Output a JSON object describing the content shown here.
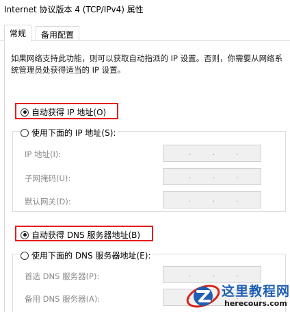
{
  "window": {
    "title": "Internet 协议版本 4 (TCP/IPv4) 属性"
  },
  "tabs": [
    {
      "label": "常规",
      "active": true
    },
    {
      "label": "备用配置",
      "active": false
    }
  ],
  "description": "如果网络支持此功能，则可以获取自动指派的 IP 设置。否则，你需要从网络系统管理员处获得适当的 IP 设置。",
  "ip_section": {
    "auto_option": {
      "label": "自动获得 IP 地址(O)",
      "selected": true
    },
    "manual_option": {
      "label": "使用下面的 IP 地址(S):",
      "selected": false
    },
    "fields": [
      {
        "label": "IP 地址(I):",
        "value": ""
      },
      {
        "label": "子网掩码(U):",
        "value": ""
      },
      {
        "label": "默认网关(D):",
        "value": ""
      }
    ]
  },
  "dns_section": {
    "auto_option": {
      "label": "自动获得 DNS 服务器地址(B)",
      "selected": true
    },
    "manual_option": {
      "label": "使用下面的 DNS 服务器地址(E):",
      "selected": false
    },
    "fields": [
      {
        "label": "首选 DNS 服务器(P):",
        "value": ""
      },
      {
        "label": "备用 DNS 服务器(A):",
        "value": ""
      }
    ]
  },
  "watermark": {
    "name": "这里教程网",
    "url": "herecours.com"
  },
  "colors": {
    "highlight": "#e0201f",
    "watermark_blue": "#1f5fb5",
    "disabled_text": "#8a8a8a",
    "disabled_field": "#f0f0f0"
  }
}
